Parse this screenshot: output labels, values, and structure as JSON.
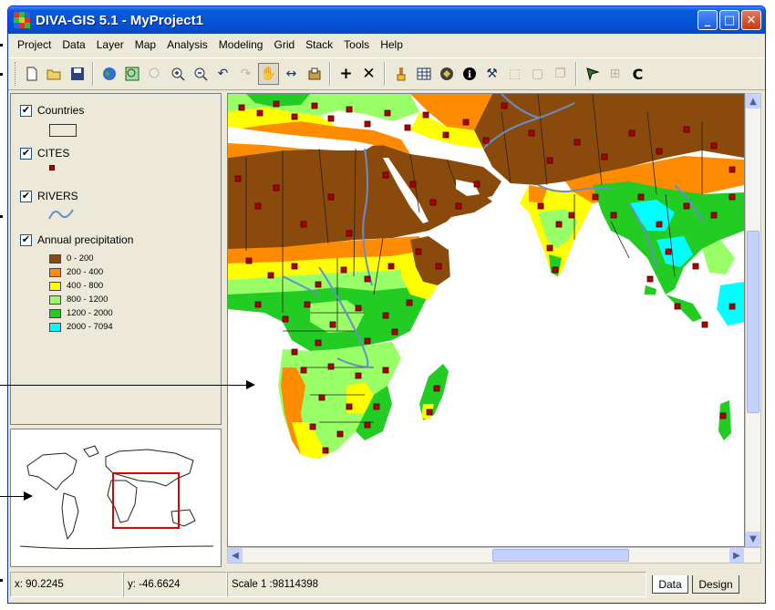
{
  "window": {
    "title": "DIVA-GIS 5.1 - MyProject1",
    "controls": {
      "minimize": "_",
      "maximize": "□",
      "close": "✕"
    }
  },
  "menu": [
    "Project",
    "Data",
    "Layer",
    "Map",
    "Analysis",
    "Modeling",
    "Grid",
    "Stack",
    "Tools",
    "Help"
  ],
  "toolbar": {
    "buttons": [
      "new-icon",
      "open-icon",
      "save-icon",
      "globe-icon",
      "zoom-extent-icon",
      "zoom-layer-icon",
      "zoom-in-icon",
      "zoom-out-icon",
      "undo-icon",
      "redo-icon",
      "pan-hand-icon",
      "stretch-icon",
      "export-icon",
      "add-layer-icon",
      "remove-layer-icon",
      "brush-icon",
      "table-icon",
      "properties-icon",
      "info-icon",
      "tools-icon",
      "select-icon",
      "deselect-icon",
      "copy-icon",
      "flag-icon",
      "grid-icon",
      "circle-icon"
    ]
  },
  "legend": {
    "layers": [
      {
        "name": "Countries",
        "checked": true
      },
      {
        "name": "CITES",
        "checked": true
      },
      {
        "name": "RIVERS",
        "checked": true
      },
      {
        "name": "Annual precipitation",
        "checked": true
      }
    ],
    "classes": [
      {
        "label": "0 - 200",
        "color": "#8a4a0b"
      },
      {
        "label": "200 - 400",
        "color": "#ff8c00"
      },
      {
        "label": "400 - 800",
        "color": "#ffff00"
      },
      {
        "label": "800 - 1200",
        "color": "#99ff66"
      },
      {
        "label": "1200 - 2000",
        "color": "#22cc22"
      },
      {
        "label": "2000 - 7094",
        "color": "#00ffff"
      }
    ],
    "country_fill": "#ece9d8",
    "point_color": "#b00000",
    "river_color": "#6a8cc8"
  },
  "status": {
    "x": "x: 90.2245",
    "y": "y: -46.6624",
    "scale": "Scale 1 :98114398",
    "tabs": [
      "Data",
      "Design"
    ]
  },
  "colors": {
    "title_bar": "#0453d6",
    "window_bg": "#ece9d8",
    "overview_box": "#e00000"
  }
}
